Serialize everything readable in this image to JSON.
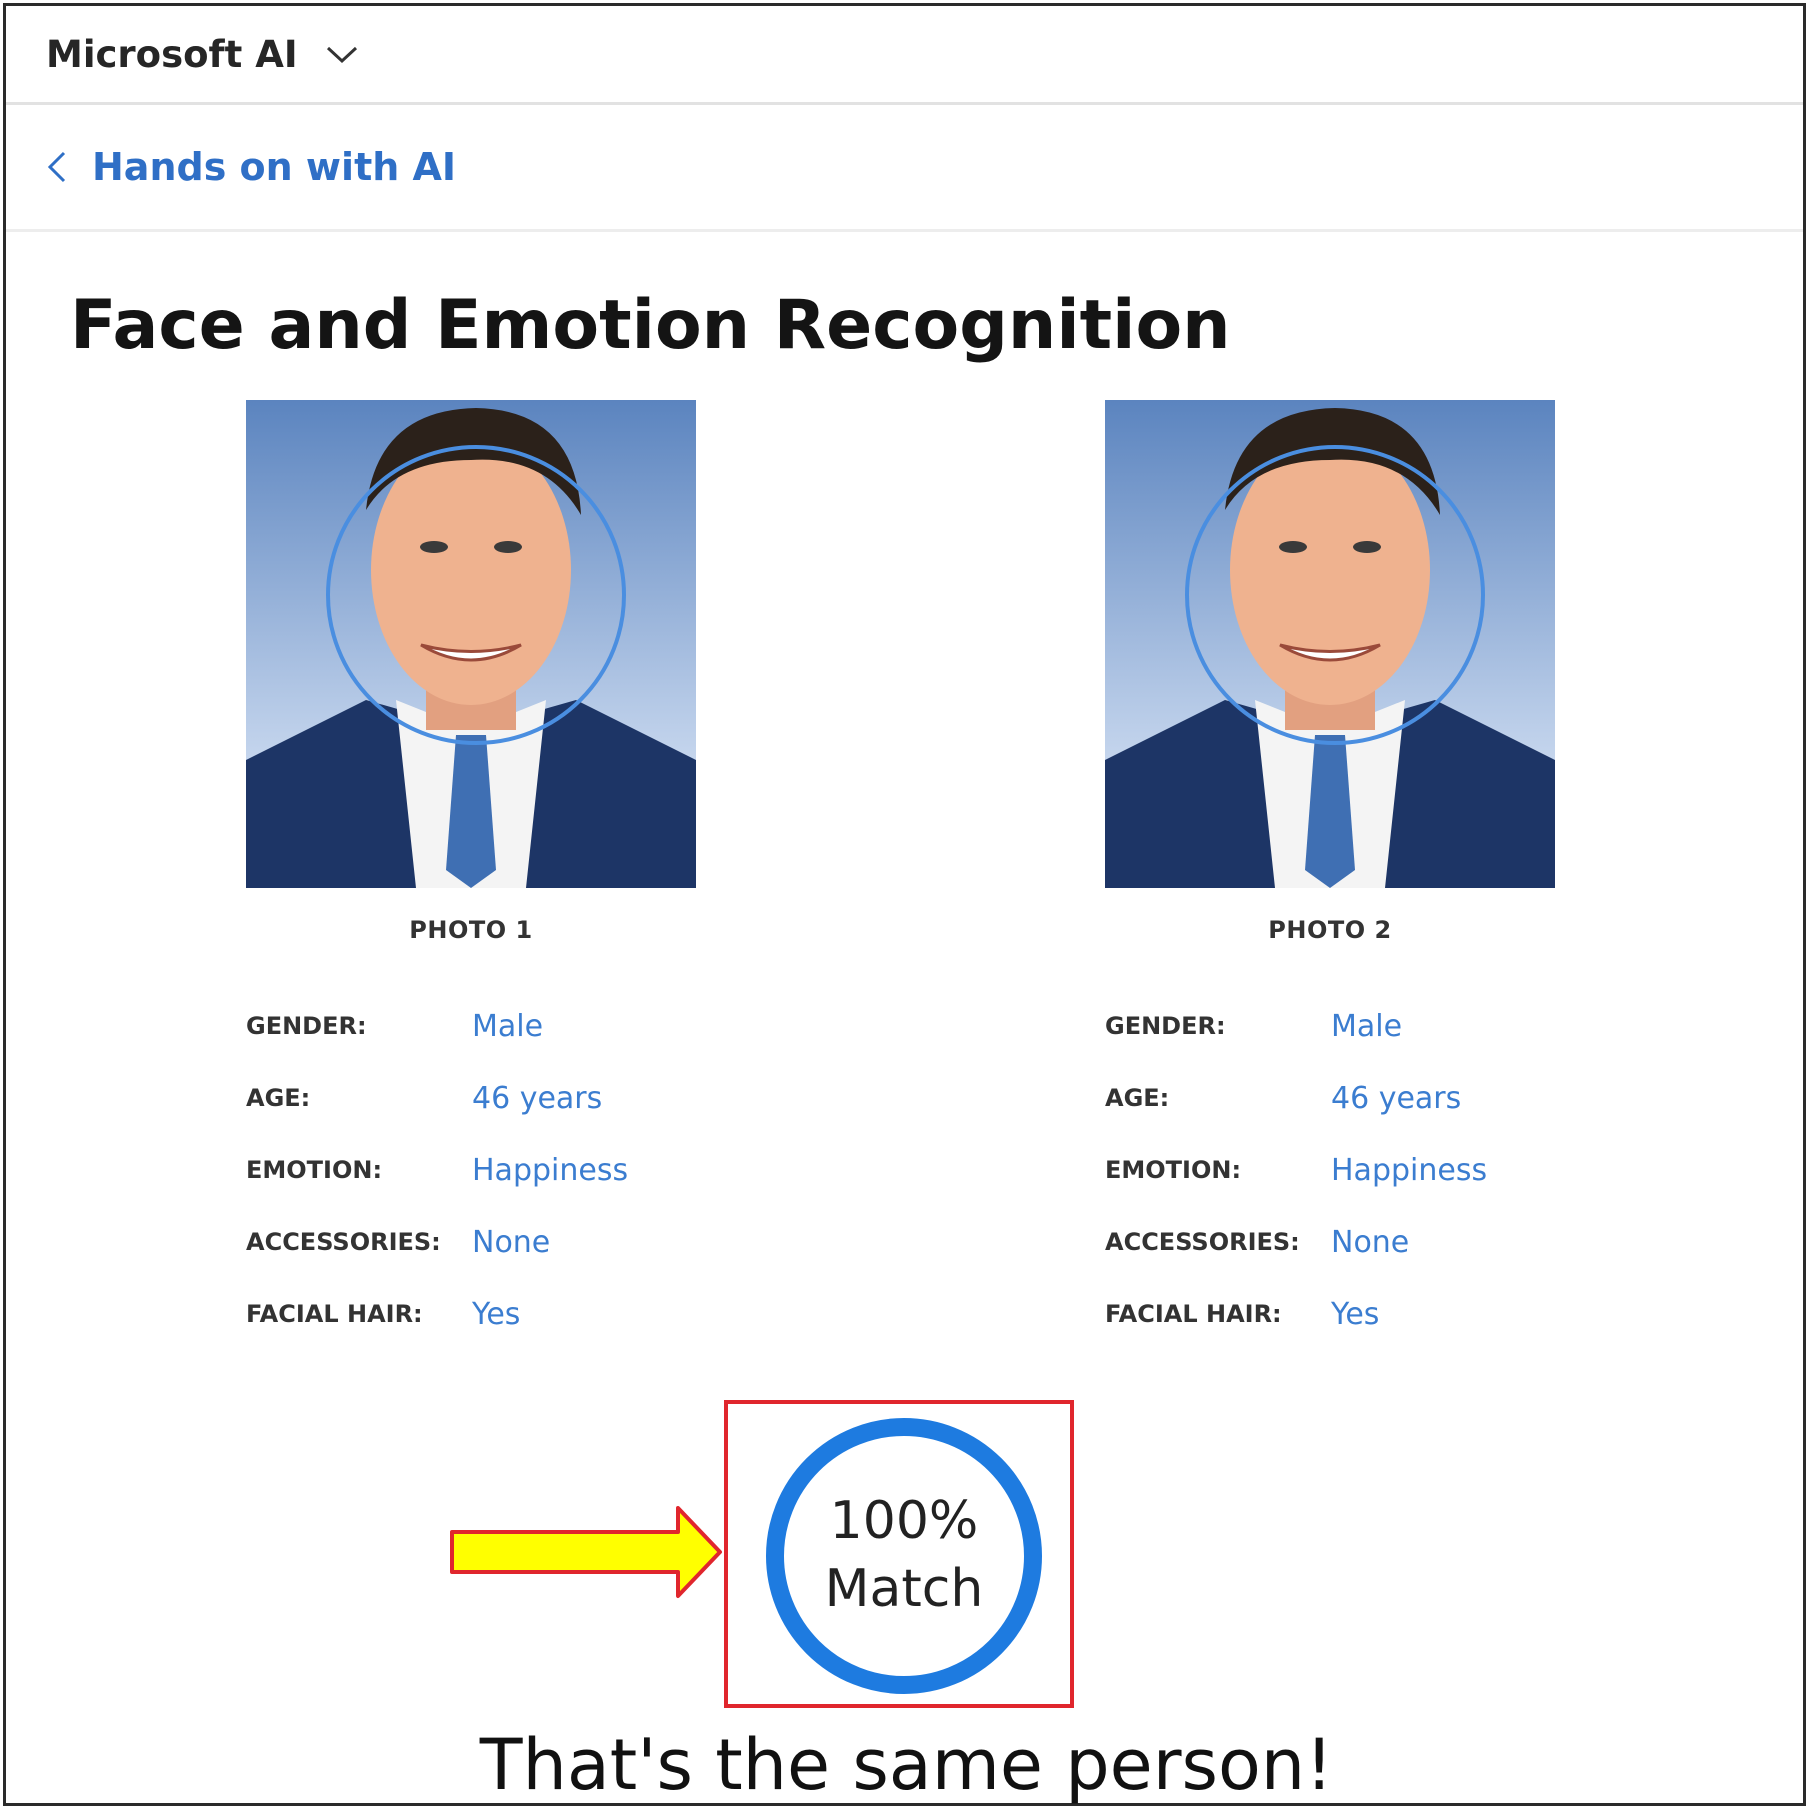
{
  "header": {
    "brand": "Microsoft AI"
  },
  "subnav": {
    "back_label": "Hands on with AI"
  },
  "page": {
    "title": "Face and Emotion Recognition"
  },
  "photos": [
    {
      "caption": "PHOTO 1",
      "attributes": [
        {
          "key": "GENDER:",
          "value": "Male"
        },
        {
          "key": "AGE:",
          "value": "46 years"
        },
        {
          "key": "EMOTION:",
          "value": "Happiness"
        },
        {
          "key": "ACCESSORIES:",
          "value": "None"
        },
        {
          "key": "FACIAL HAIR:",
          "value": "Yes"
        }
      ]
    },
    {
      "caption": "PHOTO 2",
      "attributes": [
        {
          "key": "GENDER:",
          "value": "Male"
        },
        {
          "key": "AGE:",
          "value": "46 years"
        },
        {
          "key": "EMOTION:",
          "value": "Happiness"
        },
        {
          "key": "ACCESSORIES:",
          "value": "None"
        },
        {
          "key": "FACIAL HAIR:",
          "value": "Yes"
        }
      ]
    }
  ],
  "result": {
    "percent": "100%",
    "label": "Match",
    "verdict": "That's the same person!"
  },
  "colors": {
    "link_blue": "#2f6fc6",
    "value_blue": "#3b7dd0",
    "ring_blue": "#1e7be0",
    "highlight_red": "#e0262d",
    "arrow_yellow": "#ffff00"
  },
  "icons": [
    "chevron-down-icon",
    "chevron-left-icon",
    "arrow-right-icon"
  ]
}
